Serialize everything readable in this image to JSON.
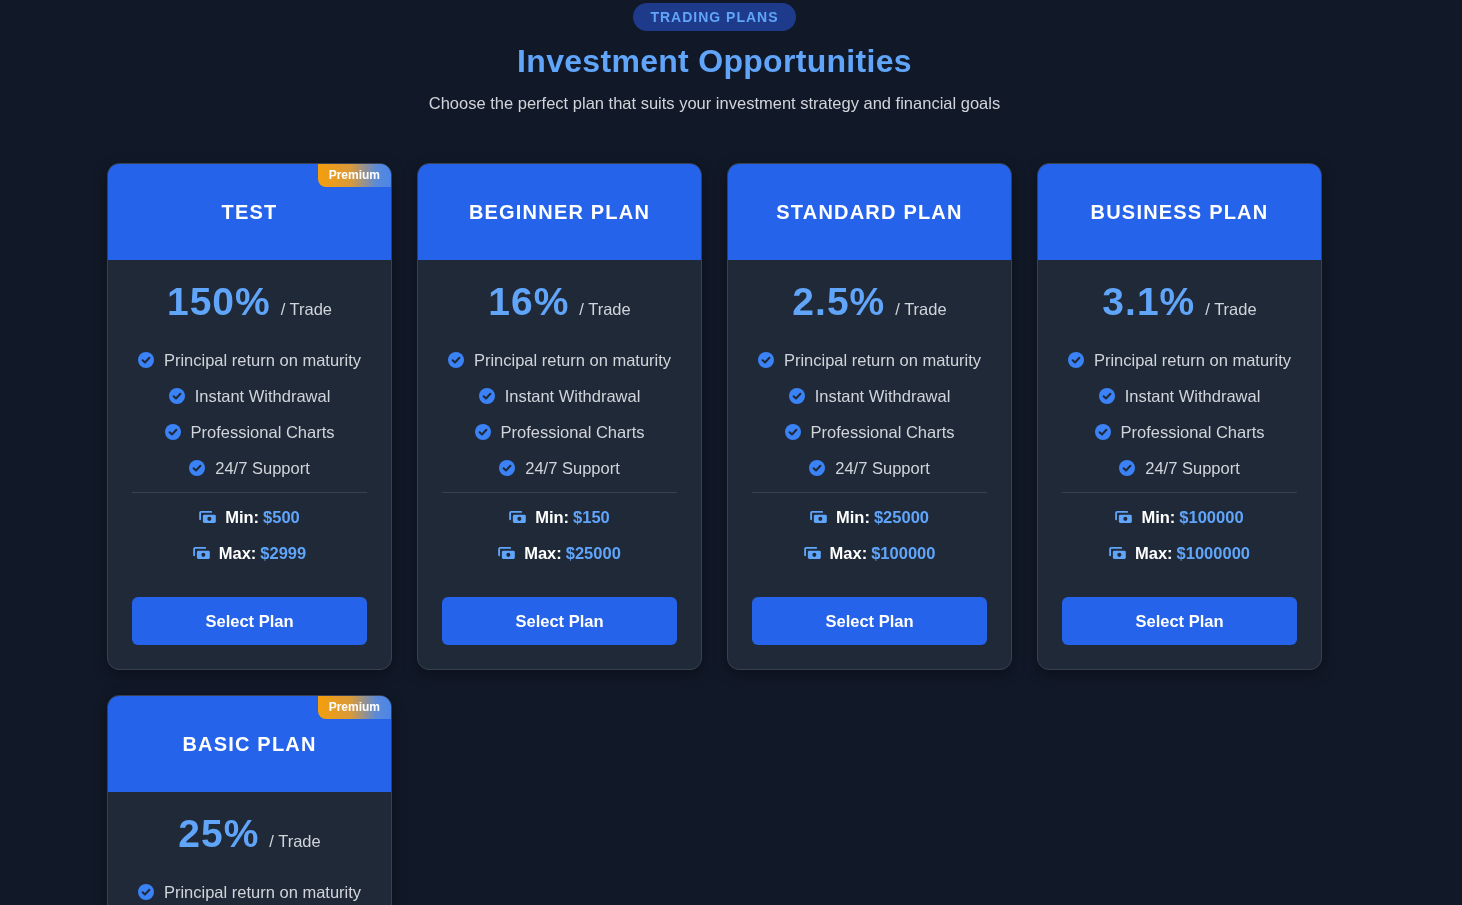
{
  "header": {
    "badge": "TRADING PLANS",
    "title": "Investment Opportunities",
    "subtitle": "Choose the perfect plan that suits your investment strategy and financial goals"
  },
  "plans": [
    {
      "name": "TEST",
      "badge": "Premium",
      "rate": "150%",
      "rate_unit": "/ Trade",
      "features": [
        "Principal return on maturity",
        "Instant Withdrawal",
        "Professional Charts",
        "24/7 Support"
      ],
      "limits": [
        {
          "label": "Min:",
          "value": "$500"
        },
        {
          "label": "Max:",
          "value": "$2999"
        }
      ],
      "button": "Select Plan"
    },
    {
      "name": "BEGINNER PLAN",
      "rate": "16%",
      "rate_unit": "/ Trade",
      "features": [
        "Principal return on maturity",
        "Instant Withdrawal",
        "Professional Charts",
        "24/7 Support"
      ],
      "limits": [
        {
          "label": "Min:",
          "value": "$150"
        },
        {
          "label": "Max:",
          "value": "$25000"
        }
      ],
      "button": "Select Plan"
    },
    {
      "name": "STANDARD PLAN",
      "rate": "2.5%",
      "rate_unit": "/ Trade",
      "features": [
        "Principal return on maturity",
        "Instant Withdrawal",
        "Professional Charts",
        "24/7 Support"
      ],
      "limits": [
        {
          "label": "Min:",
          "value": "$25000"
        },
        {
          "label": "Max:",
          "value": "$100000"
        }
      ],
      "button": "Select Plan"
    },
    {
      "name": "BUSINESS PLAN",
      "rate": "3.1%",
      "rate_unit": "/ Trade",
      "features": [
        "Principal return on maturity",
        "Instant Withdrawal",
        "Professional Charts",
        "24/7 Support"
      ],
      "limits": [
        {
          "label": "Min:",
          "value": "$100000"
        },
        {
          "label": "Max:",
          "value": "$1000000"
        }
      ],
      "button": "Select Plan"
    },
    {
      "name": "BASIC PLAN",
      "badge": "Premium",
      "rate": "25%",
      "rate_unit": "/ Trade",
      "features": [
        "Principal return on maturity"
      ]
    }
  ]
}
